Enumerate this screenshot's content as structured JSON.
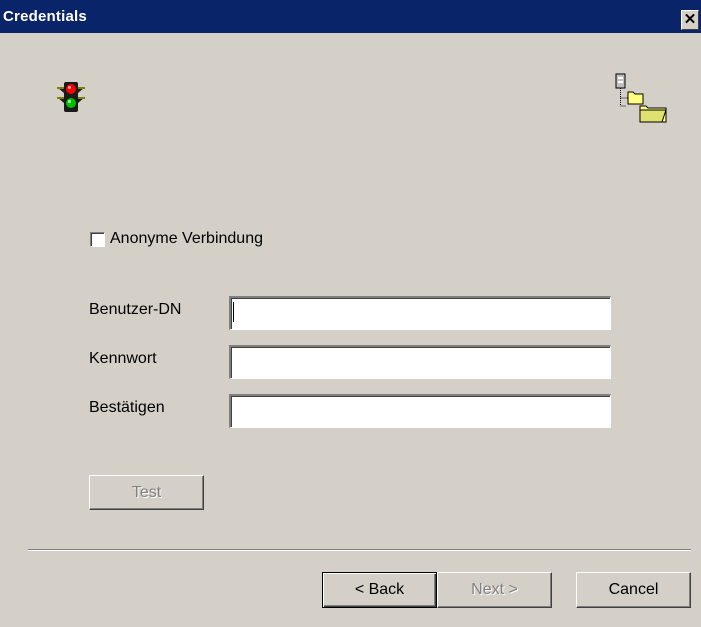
{
  "window": {
    "title": "Credentials",
    "close_label": "✕"
  },
  "icons": {
    "left": "traffic-light-icon",
    "right": "directory-tree-icon"
  },
  "anonymous": {
    "label": "Anonyme Verbindung",
    "checked": false
  },
  "fields": {
    "user_dn": {
      "label": "Benutzer-DN",
      "value": ""
    },
    "password": {
      "label": "Kennwort",
      "value": ""
    },
    "confirm": {
      "label": "Bestätigen",
      "value": ""
    }
  },
  "buttons": {
    "test": "Test",
    "back": "< Back",
    "next": "Next >",
    "cancel": "Cancel"
  }
}
